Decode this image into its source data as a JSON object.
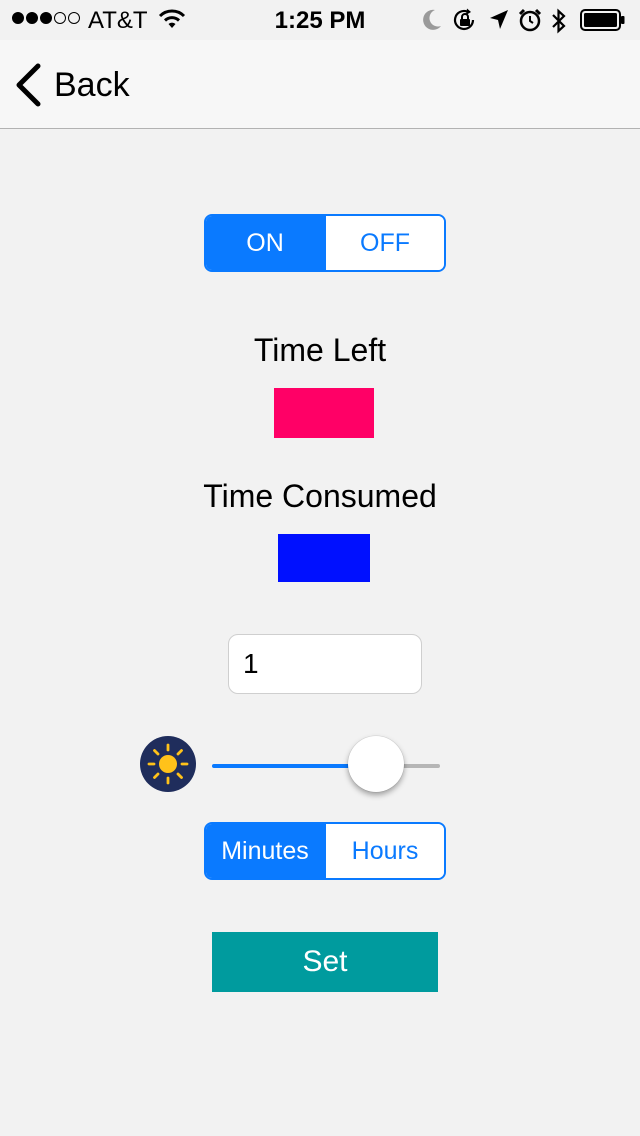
{
  "status_bar": {
    "signal_dots_filled": 3,
    "signal_dots_total": 5,
    "carrier": "AT&T",
    "time": "1:25 PM",
    "icons": [
      "wifi-icon",
      "moon-icon",
      "rotation-lock-icon",
      "location-icon",
      "alarm-icon",
      "bluetooth-icon",
      "battery-icon"
    ]
  },
  "nav": {
    "back_label": "Back",
    "icon": "chevron-left-icon"
  },
  "power_toggle": {
    "options": [
      "ON",
      "OFF"
    ],
    "selected": "ON"
  },
  "time_left": {
    "label": "Time Left",
    "color": "#ff0066"
  },
  "time_consumed": {
    "label": "Time Consumed",
    "color": "#0010ff"
  },
  "duration_input": {
    "value": "1"
  },
  "brightness_slider": {
    "icon": "sun-icon",
    "value_fraction": 0.7
  },
  "unit_toggle": {
    "options": [
      "Minutes",
      "Hours"
    ],
    "selected": "Minutes"
  },
  "set_button": {
    "label": "Set",
    "color": "#009b9e"
  },
  "colors": {
    "accent": "#0a7aff",
    "background": "#f2f2f2"
  }
}
